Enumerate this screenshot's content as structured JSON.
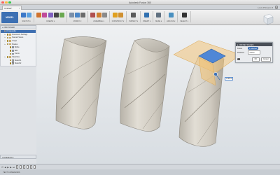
{
  "app": {
    "title": "Autodesk Fusion 360"
  },
  "document_tab": {
    "label": "Untitled*",
    "close": "×"
  },
  "user": {
    "name": "Louis Prinsens ▾",
    "help": "?"
  },
  "toolbar": {
    "workspace_label": "MODEL",
    "groups": [
      {
        "label": "SKETCH ▾",
        "icons": [
          "#3b78c8",
          "#5aa0e0"
        ]
      },
      {
        "label": "CREATE ▾",
        "icons": [
          "#d0732f",
          "#c04a9a",
          "#8060c0",
          "#444444",
          "#6aa84f"
        ]
      },
      {
        "label": "MODIFY ▾",
        "icons": [
          "#7a8fa8",
          "#4a86c8",
          "#6b6b6b"
        ]
      },
      {
        "label": "ASSEMBLE ▾",
        "icons": [
          "#b05050",
          "#d08030",
          "#8a8a8a"
        ]
      },
      {
        "label": "CONSTRUCT ▾",
        "icons": [
          "#e0a020",
          "#d09030"
        ]
      },
      {
        "label": "INSPECT ▾",
        "icons": [
          "#5a5a5a"
        ]
      },
      {
        "label": "INSERT ▾",
        "icons": [
          "#3070b0"
        ]
      },
      {
        "label": "MAKE ▾",
        "icons": [
          "#607080"
        ]
      },
      {
        "label": "ADD-INS ▾",
        "icons": [
          "#4a90c0"
        ]
      },
      {
        "label": "SELECT ▾",
        "icons": [
          "#333333"
        ]
      }
    ]
  },
  "browser": {
    "header": "BROWSER",
    "items": [
      {
        "label": "(Unsaved) ▾",
        "icon": "component-icon",
        "depth": 0
      },
      {
        "label": "Document Settings",
        "icon": "folder-icon",
        "depth": 1
      },
      {
        "label": "Named Views",
        "icon": "folder-icon",
        "depth": 1
      },
      {
        "label": "Origin",
        "icon": "folder-icon",
        "depth": 1
      },
      {
        "label": "Bodies",
        "icon": "folder-icon",
        "depth": 1
      },
      {
        "label": "Bottle",
        "icon": "body-icon",
        "depth": 2
      },
      {
        "label": "Bd1",
        "icon": "body-icon",
        "depth": 2
      },
      {
        "label": "Curve",
        "icon": "body-icon",
        "depth": 2
      },
      {
        "label": "Sketches",
        "icon": "folder-icon",
        "depth": 1
      },
      {
        "label": "Sketch1",
        "icon": "sketch-icon",
        "depth": 2
      },
      {
        "label": "Sketch2",
        "icon": "sketch-icon",
        "depth": 2
      }
    ]
  },
  "offset_panel": {
    "title": "OFFSET FACES",
    "rows": [
      {
        "label": "Faces",
        "value": "1 selected"
      },
      {
        "label": "Distance",
        "value": "-0.05 in"
      }
    ],
    "ok": "OK",
    "cancel": "Cancel"
  },
  "dimension_input": {
    "value": "-0.05 in"
  },
  "comments": {
    "label": "COMMENTS"
  },
  "status": {
    "text": "TEXT COMMANDS"
  },
  "colors": {
    "accent": "#3d70b3",
    "selection_face": "#4f87d6",
    "plane": "#f2c57a"
  }
}
